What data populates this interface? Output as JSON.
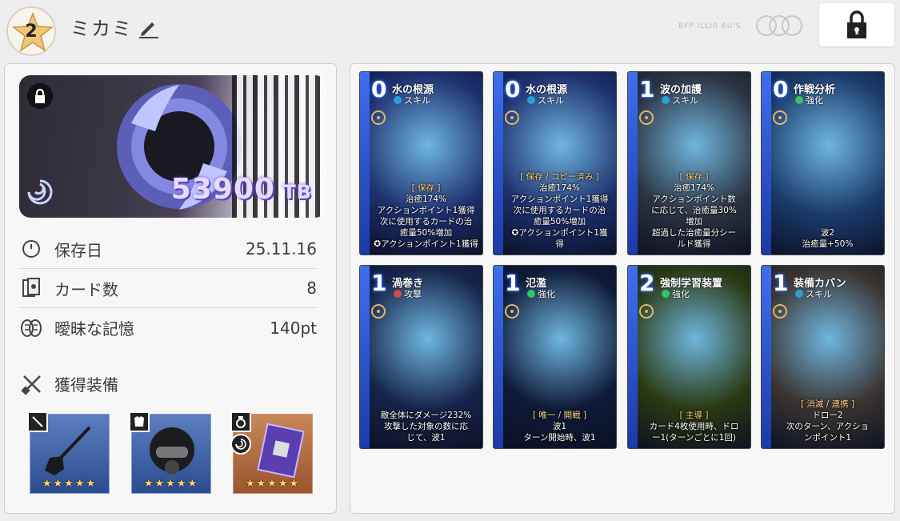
{
  "header": {
    "rank": "2",
    "player_name": "ミカミ",
    "faint_text": "BFP ILLI0 AU'S ."
  },
  "banner": {
    "value": "53900",
    "unit": "TB"
  },
  "stats": [
    {
      "icon": "clock-icon",
      "label": "保存日",
      "value": "25.11.16"
    },
    {
      "icon": "cards-icon",
      "label": "カード数",
      "value": "8"
    },
    {
      "icon": "brain-icon",
      "label": "曖昧な記憶",
      "value": "140pt"
    }
  ],
  "equipment": {
    "title": "獲得装備",
    "items": [
      {
        "name": "shovel",
        "stars": "★★★★★",
        "color": "blue",
        "tag_icon": "weapon-icon"
      },
      {
        "name": "gas-mask-helmet",
        "stars": "★★★★★",
        "color": "blue",
        "tag_icon": "armor-icon"
      },
      {
        "name": "circuit-book",
        "stars": "★★★★★",
        "color": "orange",
        "tag_icon": "ring-icon"
      }
    ]
  },
  "cards": [
    {
      "cost": "0",
      "name": "水の根源",
      "type": "スキル",
      "type_icon": "skill-icon",
      "keyword": "[ 保存 ]",
      "lines": [
        "治癒174%",
        "アクションポイント1獲得",
        "次に使用するカードの治",
        "癒量50%増加",
        "✪アクションポイント1獲得"
      ],
      "theme": "#1d2f6e"
    },
    {
      "cost": "0",
      "name": "水の根源",
      "type": "スキル",
      "type_icon": "skill-icon",
      "keyword": "[ 保存 / コピー済み ]",
      "lines": [
        "治癒174%",
        "アクションポイント1獲得",
        "次に使用するカードの治",
        "癒量50%増加",
        "✪アクションポイント1獲",
        "得"
      ],
      "theme": "#1d2f6e"
    },
    {
      "cost": "1",
      "name": "波の加護",
      "type": "スキル",
      "type_icon": "skill-icon",
      "keyword": "[ 保存 ]",
      "lines": [
        "治癒174%",
        "アクションポイント数",
        "に応じて、治癒量30%",
        "増加",
        "超過した治癒量分シー",
        "ルド獲得"
      ],
      "theme": "#2b3340"
    },
    {
      "cost": "0",
      "name": "作戦分析",
      "type": "強化",
      "type_icon": "enhance-icon",
      "keyword": "",
      "lines": [
        "波2",
        "治癒量+50%"
      ],
      "theme": "#1a3a6a"
    },
    {
      "cost": "1",
      "name": "渦巻き",
      "type": "攻撃",
      "type_icon": "attack-icon",
      "keyword": "",
      "lines": [
        "敵全体にダメージ232%",
        "攻撃した対象の数に応",
        "じて、波1"
      ],
      "theme": "#16244a"
    },
    {
      "cost": "1",
      "name": "氾濫",
      "type": "強化",
      "type_icon": "enhance-icon",
      "keyword": "[ 唯一 / 開戦 ]",
      "lines": [
        "波1",
        "ターン開始時、波1"
      ],
      "theme": "#0f1a38"
    },
    {
      "cost": "2",
      "name": "強制学習装置",
      "type": "強化",
      "type_icon": "enhance-icon",
      "keyword": "[ 主導 ]",
      "lines": [
        "カード4枚使用時、ドロ",
        "ー1(ターンごとに1回)"
      ],
      "theme": "#2a3a12"
    },
    {
      "cost": "1",
      "name": "装備カバン",
      "type": "スキル",
      "type_icon": "skill-icon",
      "keyword": "[ 消滅 / 連携 ]",
      "lines": [
        "ドロー2",
        "次のターン、アクショ",
        "ンポイント1"
      ],
      "theme": "#3a3430"
    }
  ]
}
